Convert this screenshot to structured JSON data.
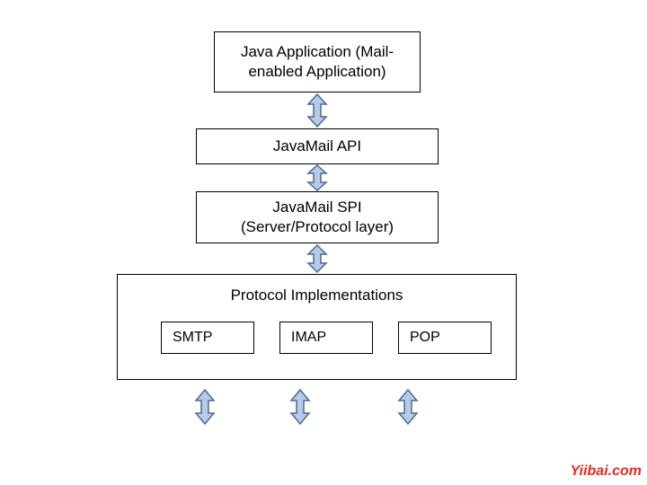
{
  "boxes": {
    "app": "Java Application (Mail-enabled Application)",
    "api": "JavaMail API",
    "spi": "JavaMail SPI\n(Server/Protocol layer)",
    "impl_title": "Protocol Implementations",
    "protocols": [
      "SMTP",
      "IMAP",
      "POP"
    ]
  },
  "watermark": "Yiibai.com",
  "arrow_fill": "#b7cce4",
  "arrow_stroke": "#4a6a9a"
}
